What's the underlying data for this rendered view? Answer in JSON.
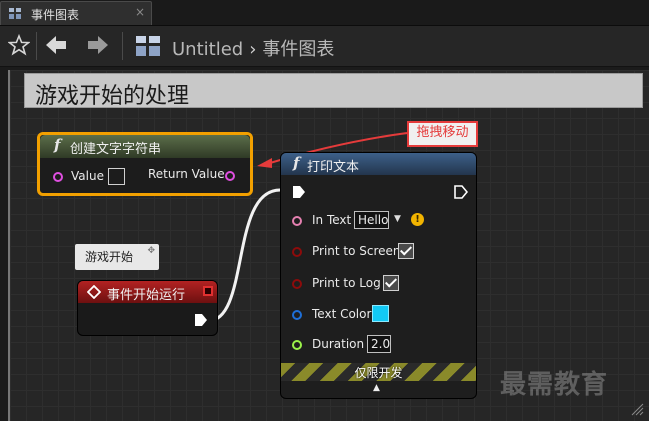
{
  "tab": {
    "label": "事件图表",
    "close": "×",
    "icon": "blueprint-icon"
  },
  "toolbar": {
    "breadcrumb_root": "Untitled",
    "breadcrumb_separator": "›",
    "breadcrumb_current": "事件图表"
  },
  "graph": {
    "comment_title": "游戏开始的处理",
    "nodes": {
      "create_string": {
        "title": "创建文字字符串",
        "value_label": "Value",
        "return_label": "Return Value"
      },
      "event_begin": {
        "bubble": "游戏开始",
        "title": "事件开始运行"
      },
      "print_text": {
        "title": "打印文本",
        "in_text_label": "In Text",
        "in_text_value": "Hello",
        "print_screen_label": "Print to Screen",
        "print_log_label": "Print to Log",
        "text_color_label": "Text Color",
        "duration_label": "Duration",
        "duration_value": "2.0",
        "dev_only": "仅限开发"
      }
    },
    "annotation": "拖拽移动",
    "watermark": "最需教育"
  },
  "colors": {
    "string_pin": "#df4fe0",
    "bool_pin": "#8d0b0b",
    "struct_pin": "#1e6fd8",
    "float_pin": "#9bf24a",
    "text_pin": "#e580b0",
    "text_color_swatch": "#12c9f5",
    "annotation_red": "#e53b3b",
    "selection_orange": "#f2a000"
  }
}
